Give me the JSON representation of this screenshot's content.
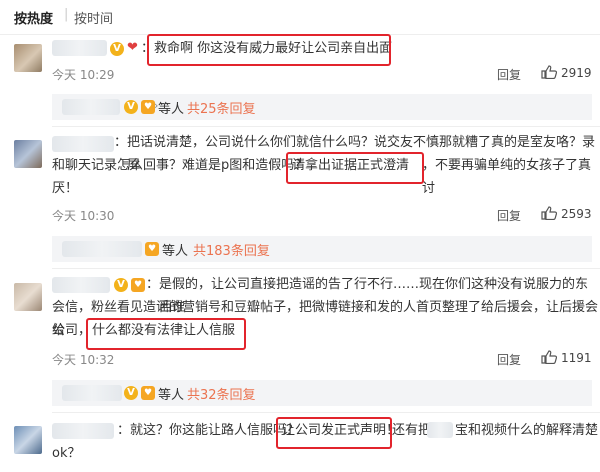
{
  "sort": {
    "hot": "按热度",
    "separator": "|",
    "time": "按时间"
  },
  "comments": [
    {
      "username_sep": "：",
      "text": "救命啊 你这没有威力最好让公司亲自出面",
      "time": "今天 10:29",
      "reply_label": "回复",
      "likes": "2919",
      "replies": {
        "who": "等人",
        "count_text": "共25条回复",
        "chevron": "›"
      }
    },
    {
      "username_sep": "：",
      "lines": [
        "把话说清楚，公司说什么你们就信什么吗？说交友不慎那就糟了真的是室友咯？录屏",
        "和聊天记录怎么回事？难道是p图和造假吗？",
        "请拿出证据正式澄清",
        "，不要再骗单纯的女孩子了真讨",
        "厌！"
      ],
      "time": "今天 10:30",
      "reply_label": "回复",
      "likes": "2593",
      "replies": {
        "who": "等人",
        "count_text": "共183条回复",
        "chevron": "›"
      }
    },
    {
      "username_sep": "：",
      "lines": [
        "是假的，让公司直接把造谣的告了行不行……现在你们这种没有说服力的东西谁",
        "会信，粉丝看见造谣的营销号和豆瓣帖子，把微博链接和发的人首页整理了给后援会，让后援会给",
        "公司，",
        "什么都没有法律让人信服"
      ],
      "time": "今天 10:32",
      "reply_label": "回复",
      "likes": "1191",
      "replies": {
        "who": "等人",
        "count_text": "共32条回复",
        "chevron": "›"
      }
    },
    {
      "username_sep": "：",
      "lines": [
        "就这？你这能让路人信服吗？",
        "让公司发正式声明！",
        "还有把",
        "宝和视频什么的解释清楚",
        "ok？"
      ]
    }
  ]
}
